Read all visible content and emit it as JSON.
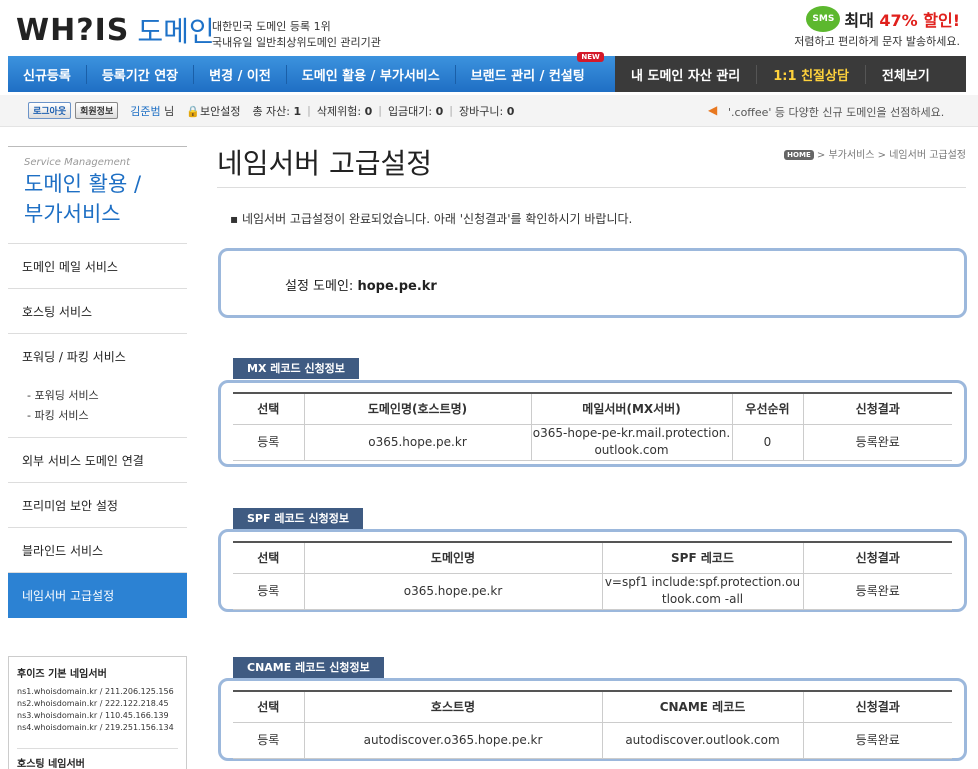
{
  "header": {
    "logo_text": "WH?IS",
    "logo_domain": "도메인",
    "tagline_1": "대한민국 도메인 등록 1위",
    "tagline_2": "국내유일 일반최상위도메인 관리기관",
    "promo_badge": "SMS",
    "promo_main_prefix": "최대",
    "promo_pct": "47% 할인!",
    "promo_sub": "저렴하고 편리하게 문자 발송하세요."
  },
  "nav": {
    "items": [
      "신규등록",
      "등록기간 연장",
      "변경 / 이전",
      "도메인 활용 / 부가서비스",
      "브랜드 관리 / 컨설팅"
    ],
    "new_badge": "NEW",
    "dark_items": [
      "내 도메인 자산 관리",
      "1:1 친절상담",
      "전체보기"
    ]
  },
  "userbar": {
    "logout": "로그아웃",
    "member_info": "회원정보",
    "user_name": "김준범",
    "user_suffix": "님",
    "security": "보안설정",
    "total_label": "총 자산:",
    "total_value": "1",
    "delete_label": "삭제위험:",
    "delete_value": "0",
    "pending_label": "입금대기:",
    "pending_value": "0",
    "cart_label": "장바구니:",
    "cart_value": "0",
    "notice": "'.coffee' 등 다양한 신규 도메인을 선점하세요."
  },
  "sidebar": {
    "en_title": "Service Management",
    "title_1": "도메인 활용 /",
    "title_2": "부가서비스",
    "items": [
      "도메인 메일 서비스",
      "호스팅 서비스",
      "포워딩 / 파킹 서비스"
    ],
    "sub_items": [
      "- 포워딩 서비스",
      "- 파킹 서비스"
    ],
    "items2": [
      "외부 서비스 도메인 연결",
      "프리미엄 보안 설정",
      "블라인드 서비스"
    ],
    "active": "네임서버 고급설정"
  },
  "nameservers": {
    "title": "후이즈 기본 네임서버",
    "lines": [
      "ns1.whoisdomain.kr / 211.206.125.156",
      "ns2.whoisdomain.kr / 222.122.218.45",
      "ns3.whoisdomain.kr / 110.45.166.139",
      "ns4.whoisdomain.kr / 219.251.156.134"
    ],
    "hosting_title": "호스팅 네임서버"
  },
  "main": {
    "title": "네임서버 고급설정",
    "crumb_home": "HOME",
    "crumb": "> 부가서비스 > 네임서버 고급설정",
    "message": "네임서버 고급설정이 완료되었습니다. 아래 '신청결과'를 확인하시기 바랍니다.",
    "domain_label": "설정 도메인:",
    "domain_value": "hope.pe.kr"
  },
  "mx": {
    "tag": "MX 레코드 신청정보",
    "headers": [
      "선택",
      "도메인명(호스트명)",
      "메일서버(MX서버)",
      "우선순위",
      "신청결과"
    ],
    "row": [
      "등록",
      "o365.hope.pe.kr",
      "o365-hope-pe-kr.mail.protection.outlook.com",
      "0",
      "등록완료"
    ]
  },
  "spf": {
    "tag": "SPF 레코드 신청정보",
    "headers": [
      "선택",
      "도메인명",
      "SPF 레코드",
      "신청결과"
    ],
    "row": [
      "등록",
      "o365.hope.pe.kr",
      "v=spf1 include:spf.protection.outlook.com -all",
      "등록완료"
    ]
  },
  "cname": {
    "tag": "CNAME 레코드 신청정보",
    "headers": [
      "선택",
      "호스트명",
      "CNAME 레코드",
      "신청결과"
    ],
    "row": [
      "등록",
      "autodiscover.o365.hope.pe.kr",
      "autodiscover.outlook.com",
      "등록완료"
    ]
  }
}
